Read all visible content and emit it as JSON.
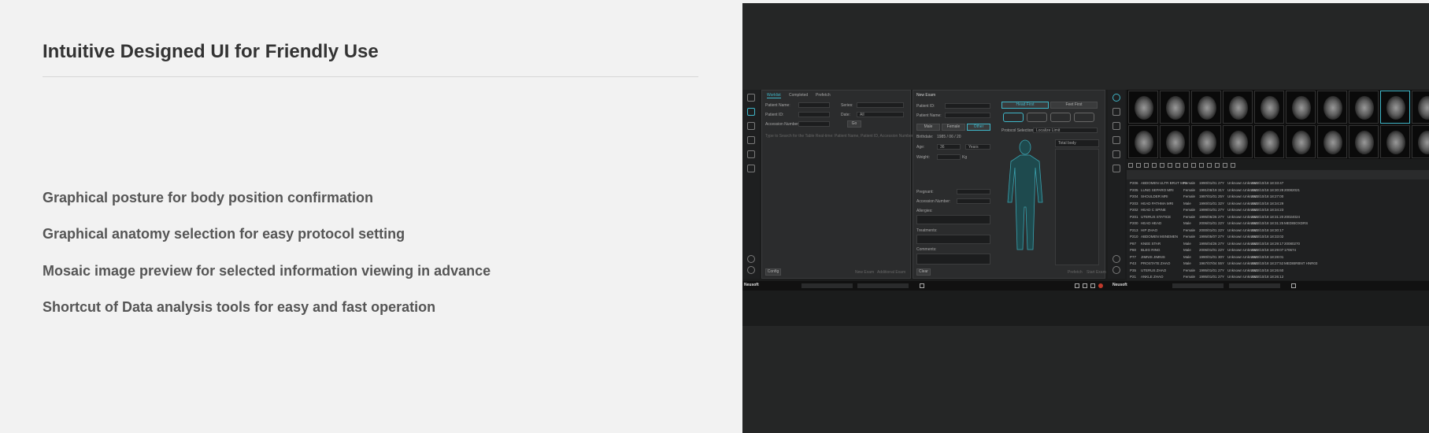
{
  "page": {
    "title": "Intuitive Designed UI for Friendly Use",
    "features": [
      "Graphical posture for body position confirmation",
      "Graphical anatomy selection for easy protocol setting",
      "Mosaic image preview for selected information viewing in advance",
      "Shortcut of Data analysis tools for easy and fast operation"
    ]
  },
  "screenshot": {
    "worklist": {
      "tabs": [
        "Worklist",
        "Completed",
        "Prefetch"
      ],
      "fields": [
        "Patient Name:",
        "Patient ID:",
        "Accession Number:"
      ],
      "filters": [
        "Series:",
        "Date:"
      ],
      "date_value": "All",
      "go_button": "Go",
      "search_hint": "Type to Search for the Table Real-time: Patient Name, Patient ID, Accession Number, Tag...",
      "config_button": "Config",
      "new_exam_button": "New Exam",
      "additional_exam_button": "Additional Exam"
    },
    "new_exam": {
      "title": "New Exam",
      "fields": [
        "Patient ID:",
        "Patient Name:"
      ],
      "sex": [
        "Male",
        "Female",
        "Other"
      ],
      "birthdate_label": "Birthdate:",
      "birthdate": "1985 / 06 / 20",
      "age_label": "Age:",
      "age": "36",
      "age_unit": "Years",
      "weight_label": "Weight:",
      "weight_unit": "Kg",
      "pregnant_label": "Pregnant:",
      "accession_label": "Accession Number:",
      "allergies_label": "Allergies:",
      "treatments_label": "Treatments:",
      "comments_label": "Comments:",
      "clear_button": "Clear",
      "posture_tabs": [
        "Head First",
        "Feet First"
      ],
      "protocol_label": "Protocol Selection:",
      "protocol_value": "Localize Limit",
      "protocol_list_header": "Total body",
      "prefetch_button": "Prefetch",
      "start_exam_button": "Start Exam"
    },
    "table": {
      "rows": [
        {
          "id": "P206",
          "name": "ABDOMEN ULTR BRUT MRI",
          "sex": "Female",
          "dob": "1990/01/01",
          "age": "27Y",
          "doc": "Unknown Unknown",
          "date": "2022/10/18 18:33:47",
          "acc": ""
        },
        {
          "id": "P205",
          "name": "LUNG SEPARO MRI",
          "sex": "Female",
          "dob": "1991/08/19",
          "age": "31Y",
          "doc": "Unknown Unknown",
          "date": "2022/10/18 18:30:28",
          "acc": "20082021"
        },
        {
          "id": "P204",
          "name": "SHOULDER MRI",
          "sex": "Female",
          "dob": "1997/01/01",
          "age": "25Y",
          "doc": "Unknown Unknown",
          "date": "2022/10/18 18:27:00",
          "acc": ""
        },
        {
          "id": "P203",
          "name": "HEAD PATHMA MRI",
          "sex": "Male",
          "dob": "1990/01/01",
          "age": "32Y",
          "doc": "Unknown Unknown",
          "date": "2022/10/18 18:34:29",
          "acc": ""
        },
        {
          "id": "P202",
          "name": "HEAD C SPINE",
          "sex": "Female",
          "dob": "1999/01/01",
          "age": "27Y",
          "doc": "Unknown Unknown",
          "date": "2022/10/18 18:34:23",
          "acc": ""
        },
        {
          "id": "P201",
          "name": "UTERUS STATICE",
          "sex": "Female",
          "dob": "1995/06/26",
          "age": "27Y",
          "doc": "Unknown Unknown",
          "date": "2022/10/18 18:31:20",
          "acc": "20024024"
        },
        {
          "id": "P200",
          "name": "HEAD HEAD",
          "sex": "Male",
          "dob": "2006/01/01",
          "age": "22Y",
          "doc": "Unknown Unknown",
          "date": "2022/10/18 18:31:25",
          "acc": "MEDIBOXDRS"
        },
        {
          "id": "P213",
          "name": "HIP ZHAO",
          "sex": "Female",
          "dob": "2000/01/01",
          "age": "22Y",
          "doc": "Unknown Unknown",
          "date": "2022/10/18 18:30:17",
          "acc": ""
        },
        {
          "id": "P210",
          "name": "ABDOMEN MSNEMEN",
          "sex": "Female",
          "dob": "1995/05/07",
          "age": "27Y",
          "doc": "Unknown Unknown",
          "date": "2022/10/18 18:33:02",
          "acc": ""
        },
        {
          "id": "P87",
          "name": "KNEE STAR",
          "sex": "Male",
          "dob": "1995/04/26",
          "age": "27Y",
          "doc": "Unknown Unknown",
          "date": "2022/10/18 18:29:17",
          "acc": "20080270"
        },
        {
          "id": "P80",
          "name": "BLEG RING",
          "sex": "Male",
          "dob": "2006/01/01",
          "age": "22Y",
          "doc": "Unknown Unknown",
          "date": "2022/10/18 18:29:07",
          "acc": "170674"
        },
        {
          "id": "P77",
          "name": "JIMNIS JIMNIS",
          "sex": "Male",
          "dob": "1990/01/01",
          "age": "30Y",
          "doc": "Unknown Unknown",
          "date": "2022/10/18 18:28:01",
          "acc": ""
        },
        {
          "id": "P43",
          "name": "PROSTATE ZHAO",
          "sex": "Male",
          "dob": "1967/07/04",
          "age": "55Y",
          "doc": "Unknown Unknown",
          "date": "2022/10/18 18:27:52",
          "acc": "MEDIBRBNT HNR03"
        },
        {
          "id": "P35",
          "name": "UTERUS ZHAO",
          "sex": "Female",
          "dob": "1995/01/01",
          "age": "27Y",
          "doc": "Unknown Unknown",
          "date": "2022/10/18 18:26:60",
          "acc": ""
        },
        {
          "id": "P21",
          "name": "ANKLE ZHAO",
          "sex": "Female",
          "dob": "1995/01/01",
          "age": "27Y",
          "doc": "Unknown Unknown",
          "date": "2022/10/18 18:26:12",
          "acc": ""
        }
      ]
    },
    "brand": "Neusoft"
  }
}
